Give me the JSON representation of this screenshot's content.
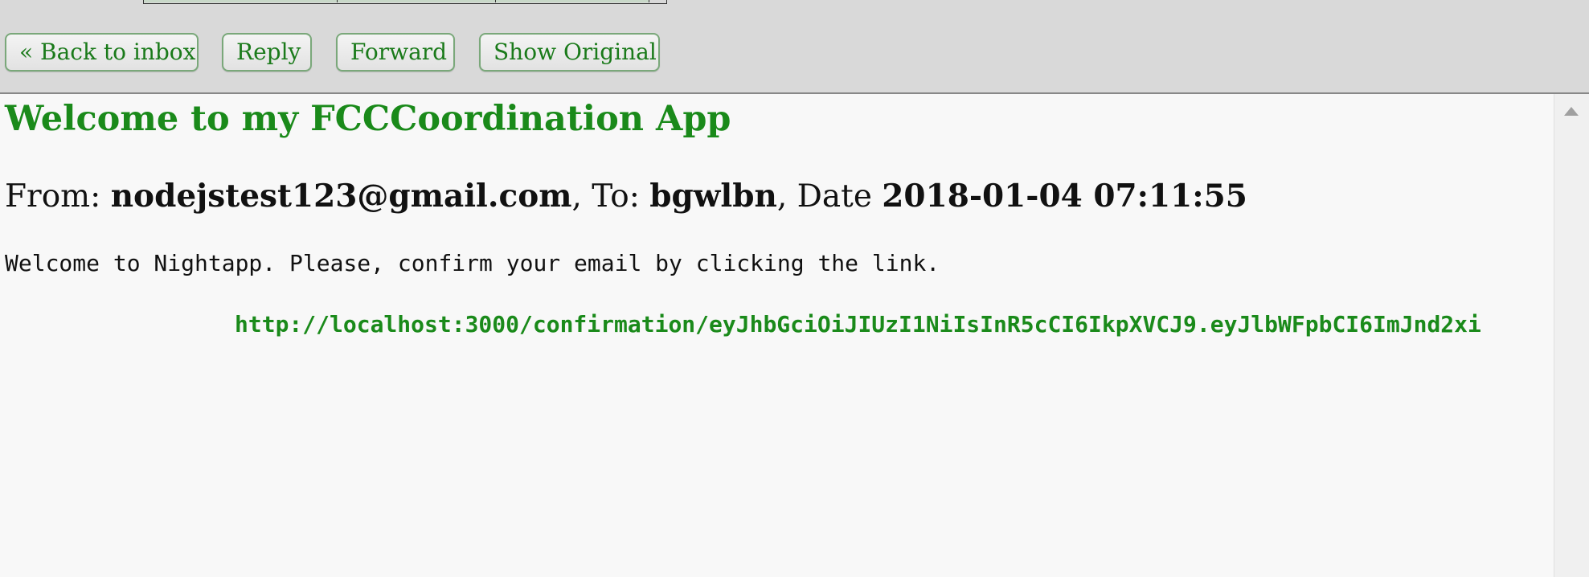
{
  "toolbar": {
    "back_label": "« Back to inbox",
    "reply_label": "Reply",
    "forward_label": "Forward",
    "show_original_label": "Show Original"
  },
  "message": {
    "subject": "Welcome to my FCCCoordination App",
    "from_prefix": "From: ",
    "from": "nodejstest123@gmail.com",
    "to_prefix": ", To: ",
    "to": "bgwlbn",
    "date_prefix": ", Date ",
    "date": "2018-01-04 07:11:55",
    "body": "Welcome to Nightapp. Please, confirm your email by clicking the link.",
    "link": "http://localhost:3000/confirmation/eyJhbGciOiJIUzI1NiIsInR5cCI6IkpXVCJ9.eyJlbWFpbCI6ImJnd2xi"
  },
  "colors": {
    "accent_green": "#1a8a1a",
    "toolbar_bg": "#d9d9d9",
    "content_bg": "#f8f8f8"
  },
  "icons": {
    "scroll_up": "scroll-up-arrow-icon"
  }
}
